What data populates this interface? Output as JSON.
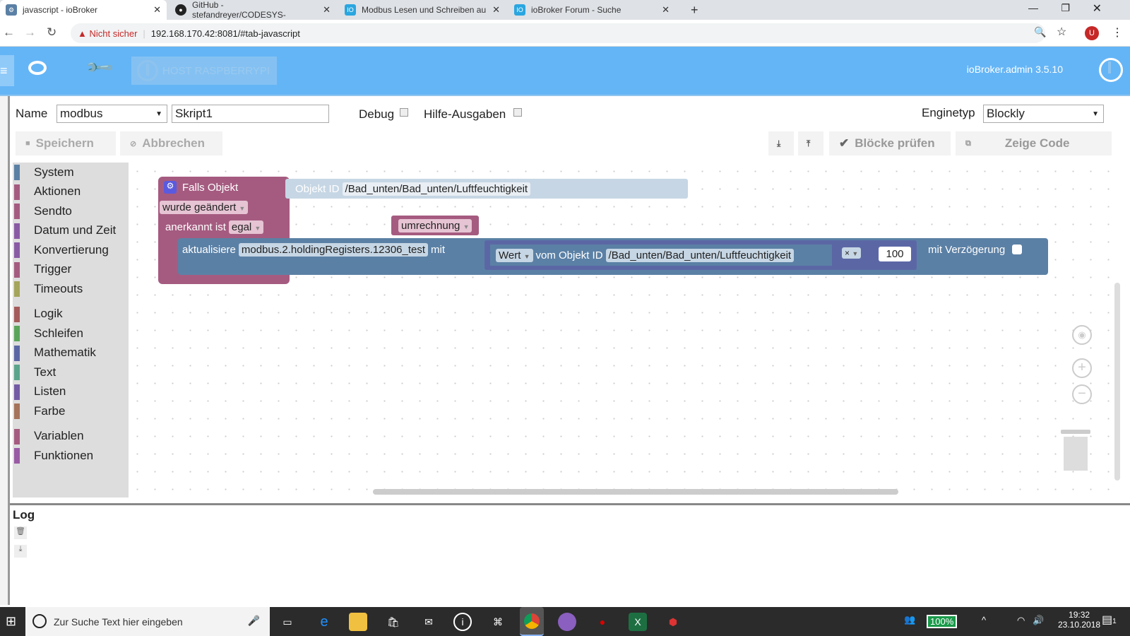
{
  "browser": {
    "tabs": [
      {
        "title": "javascript - ioBroker",
        "active": true
      },
      {
        "title": "GitHub - stefandreyer/CODESYS-"
      },
      {
        "title": "Modbus Lesen und Schreiben au"
      },
      {
        "title": "ioBroker Forum - Suche"
      }
    ],
    "close_glyph": "✕",
    "new_tab_glyph": "+",
    "security_warning": "Nicht sicher",
    "url": "192.168.170.42:8081/#tab-javascript",
    "profile_initial": "U"
  },
  "header": {
    "host_label": "HOST RASPBERRYPI",
    "version": "ioBroker.admin 3.5.10",
    "accent": "#64b5f6"
  },
  "editor": {
    "name_label": "Name",
    "name_select": "modbus",
    "script_name": "Skript1",
    "debug_label": "Debug",
    "debug_checked": false,
    "hilfe_label": "Hilfe-Ausgaben",
    "hilfe_checked": false,
    "engine_label": "Enginetyp",
    "engine_value": "Blockly",
    "save_label": "Speichern",
    "cancel_label": "Abbrechen",
    "check_label": "Blöcke prüfen",
    "show_code_label": "Zeige Code"
  },
  "categories": [
    {
      "label": "System",
      "color": "#5b80a5"
    },
    {
      "label": "Aktionen",
      "color": "#a55b80"
    },
    {
      "label": "Sendto",
      "color": "#a55b80"
    },
    {
      "label": "Datum und Zeit",
      "color": "#8a5ba5"
    },
    {
      "label": "Konvertierung",
      "color": "#8a5ba5"
    },
    {
      "label": "Trigger",
      "color": "#a55b80"
    },
    {
      "label": "Timeouts",
      "color": "#a5a55b"
    },
    {
      "label": "Logik",
      "color": "#a55b5b"
    },
    {
      "label": "Schleifen",
      "color": "#5ba55b"
    },
    {
      "label": "Mathematik",
      "color": "#5b67a5"
    },
    {
      "label": "Text",
      "color": "#5ba58c"
    },
    {
      "label": "Listen",
      "color": "#745ba5"
    },
    {
      "label": "Farbe",
      "color": "#a5745b"
    },
    {
      "label": "Variablen",
      "color": "#a55b80"
    },
    {
      "label": "Funktionen",
      "color": "#995ba5"
    }
  ],
  "blocks": {
    "trigger_title": "Falls Objekt",
    "objekt_id_label": "Objekt ID",
    "trigger_oid": "/Bad_unten/Bad_unten/Luftfeuchtigkeit",
    "changed": "wurde geändert",
    "ack_label": "anerkannt ist",
    "ack_value": "egal",
    "function_call": "umrechnung",
    "update_label": "aktualisiere",
    "update_oid": "modbus.2.holdingRegisters.12306_test",
    "with_label": "mit",
    "value_select": "Wert",
    "from_label": "vom Objekt ID",
    "value_oid": "/Bad_unten/Bad_unten/Luftfeuchtigkeit",
    "operator": "×",
    "operand": "100",
    "delay_label": "mit Verzögerung"
  },
  "log": {
    "title": "Log"
  },
  "taskbar": {
    "search_placeholder": "Zur Suche Text hier eingeben",
    "battery": "100%",
    "time": "19:32",
    "date": "23.10.2018",
    "notifications": "1"
  }
}
